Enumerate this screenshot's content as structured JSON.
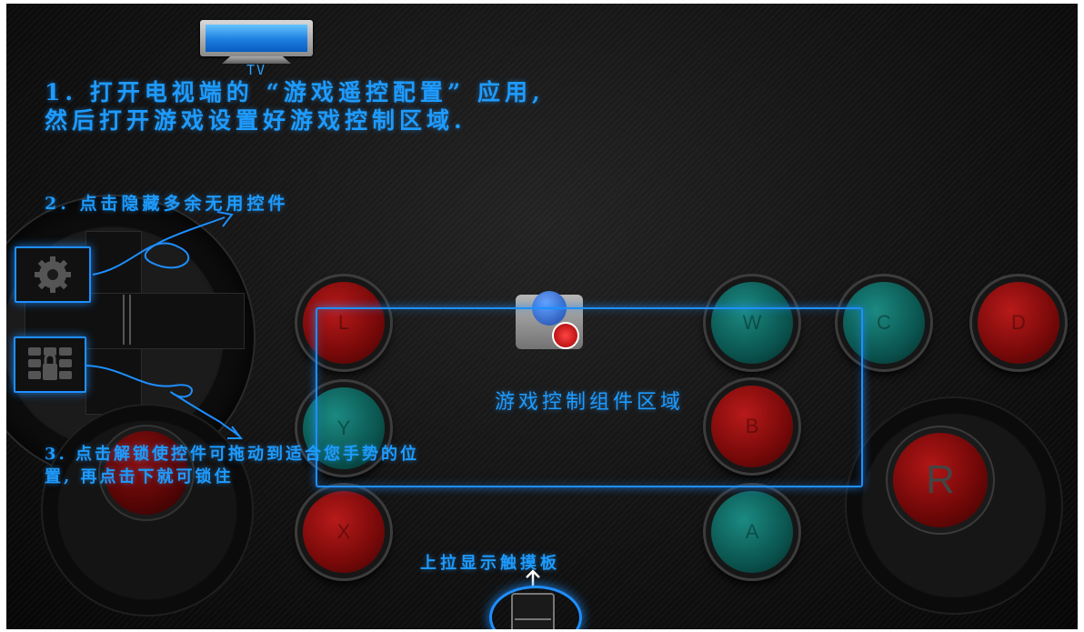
{
  "tv": {
    "label": "TV"
  },
  "hints": {
    "step1": "1. 打开电视端的 “游戏遥控配置” 应用, 然后打开游戏设置好游戏控制区域.",
    "step2": "2. 点击隐藏多余无用控件",
    "step3": "3. 点击解锁使控件可拖动到适合您手势的位置, 再点击下就可锁住",
    "touchpad": "上拉显示触摸板"
  },
  "game_area": {
    "label": "游戏控制组件区域"
  },
  "buttons": {
    "l1": "L",
    "w": "W",
    "c": "C",
    "d": "D",
    "y": "Y",
    "b": "B",
    "x": "X",
    "a": "A"
  },
  "right_joystick": {
    "label": "R"
  },
  "icons": {
    "settings": "gear-icon",
    "lock": "keypad-lock-icon",
    "tv": "tv-icon",
    "touchpad": "touchpad-icon",
    "sd_card": "sd-card-icon"
  },
  "colors": {
    "accent": "#1e9bff",
    "button_red": "#8a0f0f",
    "button_teal": "#0e6b65",
    "background": "#141414"
  }
}
